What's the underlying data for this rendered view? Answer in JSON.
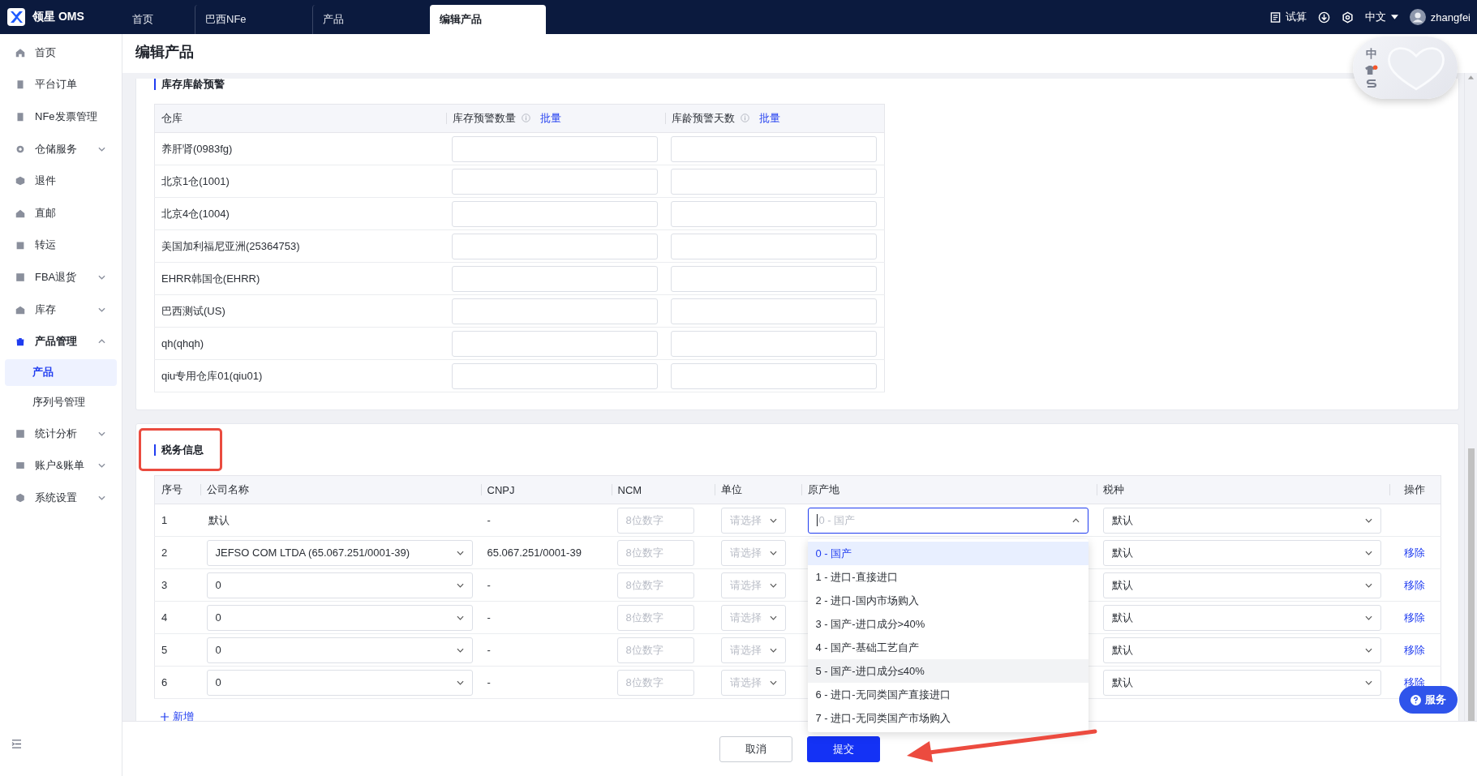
{
  "brand": {
    "name": "领星 OMS"
  },
  "tabs": [
    {
      "label": "首页",
      "selected": false
    },
    {
      "label": "巴西NFe",
      "selected": false
    },
    {
      "label": "产品",
      "selected": false
    },
    {
      "label": "编辑产品",
      "selected": true
    }
  ],
  "toolbar": {
    "calculator_label": "试算",
    "language": "中文",
    "username": "zhangfei"
  },
  "ime_widget": {
    "label": "中",
    "notification": true
  },
  "sidebar": {
    "items": [
      {
        "label": "首页",
        "kind": "link",
        "selected": false
      },
      {
        "label": "平台订单",
        "kind": "link",
        "selected": false
      },
      {
        "label": "NFe发票管理",
        "kind": "link",
        "selected": false
      },
      {
        "label": "仓储服务",
        "kind": "group",
        "selected": false,
        "expanded": false
      },
      {
        "label": "退件",
        "kind": "link",
        "selected": false
      },
      {
        "label": "直邮",
        "kind": "link",
        "selected": false
      },
      {
        "label": "转运",
        "kind": "link",
        "selected": false
      },
      {
        "label": "FBA退货",
        "kind": "group",
        "selected": false,
        "expanded": false
      },
      {
        "label": "库存",
        "kind": "group",
        "selected": false,
        "expanded": false
      },
      {
        "label": "产品管理",
        "kind": "group",
        "selected": true,
        "expanded": true,
        "children": [
          {
            "label": "产品",
            "selected": true
          },
          {
            "label": "序列号管理",
            "selected": false
          }
        ]
      },
      {
        "label": "统计分析",
        "kind": "group",
        "selected": false,
        "expanded": false
      },
      {
        "label": "账户&账单",
        "kind": "group",
        "selected": false,
        "expanded": false
      },
      {
        "label": "系统设置",
        "kind": "group",
        "selected": false,
        "expanded": false
      }
    ]
  },
  "page_title": "编辑产品",
  "inventory_warning": {
    "title": "库存库龄预警",
    "columns": [
      {
        "label": "仓库",
        "info": false
      },
      {
        "label": "库存预警数量",
        "info": true,
        "action": "批量"
      },
      {
        "label": "库龄预警天数",
        "info": true,
        "action": "批量"
      }
    ],
    "rows": [
      {
        "warehouse": "养肝肾(0983fg)"
      },
      {
        "warehouse": "北京1仓(1001)"
      },
      {
        "warehouse": "北京4仓(1004)"
      },
      {
        "warehouse": "美国加利福尼亚洲(25364753)"
      },
      {
        "warehouse": "EHRR韩国仓(EHRR)"
      },
      {
        "warehouse": "巴西测试(US)"
      },
      {
        "warehouse": "qh(qhqh)"
      },
      {
        "warehouse": "qiu专用仓库01(qiu01)"
      }
    ]
  },
  "tax_info": {
    "title": "税务信息",
    "highlighted": true,
    "columns": [
      "序号",
      "公司名称",
      "CNPJ",
      "NCM",
      "单位",
      "原产地",
      "税种",
      "操作"
    ],
    "rows": [
      {
        "no": "1",
        "company": {
          "kind": "text",
          "value": "默认"
        },
        "cnpj": "-",
        "ncm_placeholder": "8位数字",
        "unit_placeholder": "请选择",
        "origin": {
          "placeholder": "0 - 国产",
          "open": true,
          "options": [
            {
              "label": "0 - 国产",
              "selected": true,
              "hovered": false
            },
            {
              "label": "1 - 进口-直接进口",
              "selected": false,
              "hovered": false
            },
            {
              "label": "2 - 进口-国内市场购入",
              "selected": false,
              "hovered": false
            },
            {
              "label": "3 - 国产-进口成分>40%",
              "selected": false,
              "hovered": false
            },
            {
              "label": "4 - 国产-基础工艺自产",
              "selected": false,
              "hovered": false
            },
            {
              "label": "5 - 国产-进口成分≤40%",
              "selected": false,
              "hovered": true
            },
            {
              "label": "6 - 进口-无同类国产直接进口",
              "selected": false,
              "hovered": false
            },
            {
              "label": "7 - 进口-无同类国产市场购入",
              "selected": false,
              "hovered": false
            }
          ]
        },
        "tax_type": "默认"
      },
      {
        "no": "2",
        "company": {
          "kind": "select",
          "value": "JEFSO COM LTDA (65.067.251/0001-39)"
        },
        "cnpj": "65.067.251/0001-39",
        "ncm_placeholder": "8位数字",
        "unit_placeholder": "请选择",
        "tax_type": "默认",
        "action": "移除"
      },
      {
        "no": "3",
        "company": {
          "kind": "select",
          "value": "0"
        },
        "cnpj": "-",
        "ncm_placeholder": "8位数字",
        "unit_placeholder": "请选择",
        "tax_type": "默认",
        "action": "移除"
      },
      {
        "no": "4",
        "company": {
          "kind": "select",
          "value": "0"
        },
        "cnpj": "-",
        "ncm_placeholder": "8位数字",
        "unit_placeholder": "请选择",
        "tax_type": "默认",
        "action": "移除"
      },
      {
        "no": "5",
        "company": {
          "kind": "select",
          "value": "0"
        },
        "cnpj": "-",
        "ncm_placeholder": "8位数字",
        "unit_placeholder": "请选择",
        "tax_type": "默认",
        "action": "移除"
      },
      {
        "no": "6",
        "company": {
          "kind": "select",
          "value": "0"
        },
        "cnpj": "-",
        "ncm_placeholder": "8位数字",
        "unit_placeholder": "请选择",
        "tax_type": "默认",
        "action": "移除"
      }
    ],
    "add_label": "新增"
  },
  "footer": {
    "cancel": "取消",
    "submit": "提交"
  },
  "service_button": "服务"
}
